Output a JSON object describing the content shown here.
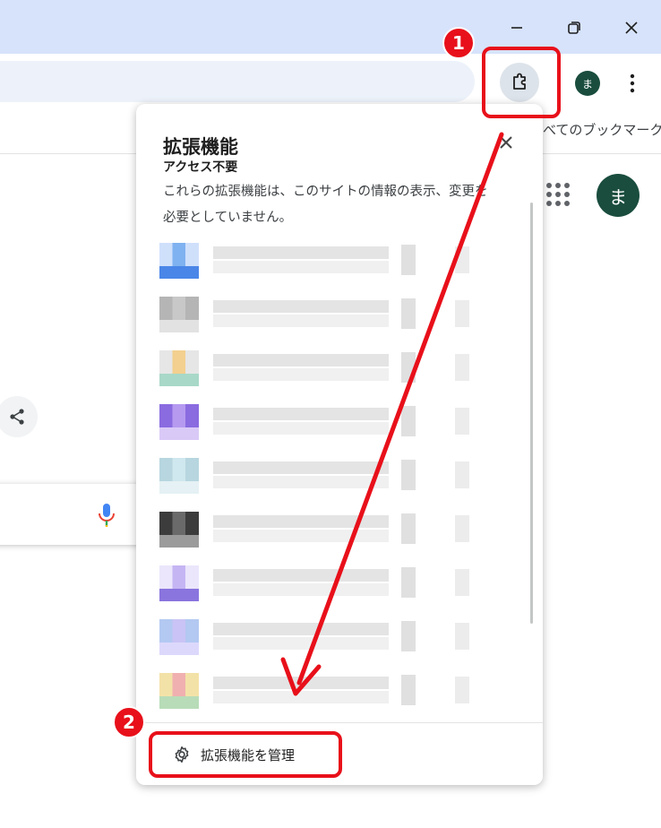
{
  "window": {
    "minimize_icon": "minimize-icon",
    "restore_icon": "restore-icon",
    "close_icon": "close-icon"
  },
  "toolbar": {
    "extensions_icon": "puzzle-icon",
    "profile_initial": "ま",
    "menu_icon": "kebab-menu-icon"
  },
  "bookmarks_bar": {
    "all_bookmarks_label": "べてのブックマーク"
  },
  "page": {
    "avatar_initial": "ま",
    "apps_icon": "apps-grid-icon",
    "share_icon": "share-icon",
    "mic_icon": "microphone-icon"
  },
  "popup": {
    "title": "拡張機能",
    "subtitle": "アクセス不要",
    "description": "これらの拡張機能は、このサイトの情報の表示、変更を必要としていません。",
    "close_icon": "close-icon",
    "extensions": [
      {
        "colors": [
          "#7fb2f0",
          "#4a86e8",
          "#cfe0fb"
        ]
      },
      {
        "colors": [
          "#c8c8c8",
          "#e2e2e2",
          "#b5b5b5"
        ]
      },
      {
        "colors": [
          "#f3d08f",
          "#a8d8c8",
          "#e6e6e6"
        ]
      },
      {
        "colors": [
          "#b59af0",
          "#d9c9f7",
          "#8a6be0"
        ]
      },
      {
        "colors": [
          "#cfe7ee",
          "#e5f1f4",
          "#b7d6df"
        ]
      },
      {
        "colors": [
          "#6a6a6a",
          "#9b9b9b",
          "#3c3c3c"
        ]
      },
      {
        "colors": [
          "#c5b5f3",
          "#8a74de",
          "#ebe6fb"
        ]
      },
      {
        "colors": [
          "#c9c4f5",
          "#dcd8fb",
          "#b3c9f2"
        ]
      },
      {
        "colors": [
          "#f0b0b0",
          "#b8dcb8",
          "#f3e2a8"
        ]
      }
    ],
    "manage_label": "拡張機能を管理",
    "manage_icon": "gear-icon"
  },
  "annotations": {
    "step1": "1",
    "step2": "2",
    "color": "#e8101a"
  }
}
